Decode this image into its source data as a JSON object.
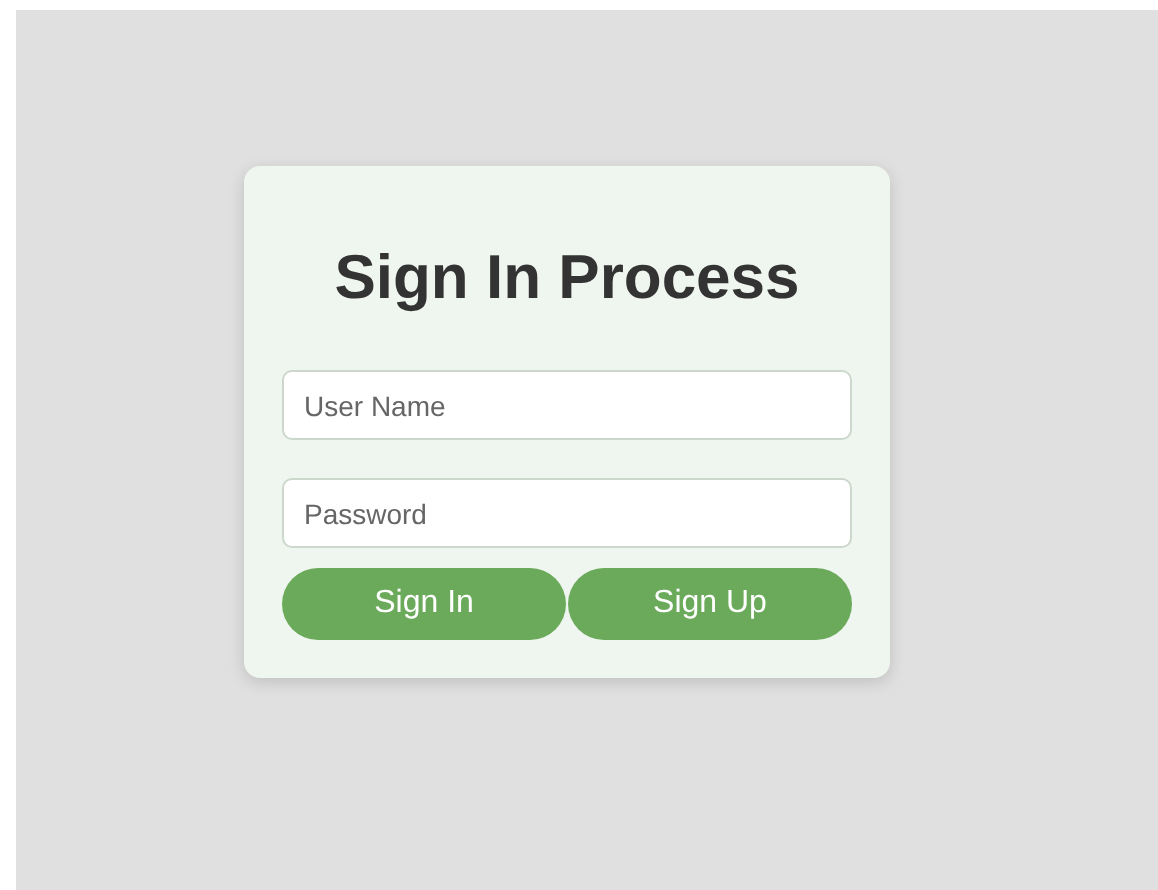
{
  "title": "Sign In Process",
  "fields": [
    {
      "placeholder": "User Name"
    },
    {
      "placeholder": "Password"
    }
  ],
  "buttons": [
    {
      "label": "Sign In"
    },
    {
      "label": "Sign Up"
    }
  ]
}
